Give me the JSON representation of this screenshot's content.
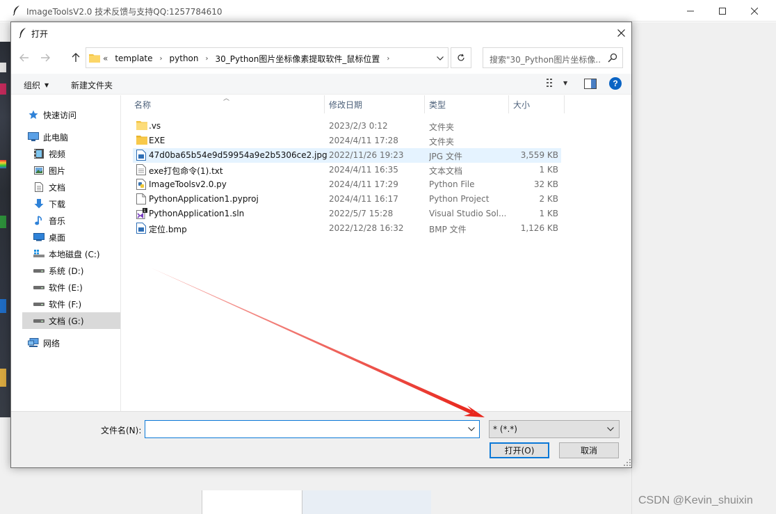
{
  "main_window": {
    "title": "ImageToolsV2.0 技术反馈与支持QQ:1257784610",
    "min_label": "—",
    "max_label": "☐",
    "close_label": "✕"
  },
  "dialog": {
    "title": "打开",
    "close_label": "✕",
    "address": {
      "lead": "«",
      "crumbs": [
        "template",
        "python",
        "30_Python图片坐标像素提取软件_鼠标位置"
      ],
      "separator": "›"
    },
    "search_placeholder": "搜索\"30_Python图片坐标像...",
    "toolbar": {
      "organize": "组织",
      "new_folder": "新建文件夹"
    },
    "nav": [
      {
        "label": "快速访问",
        "icon": "star-icon"
      },
      {
        "label": "此电脑",
        "icon": "computer-icon"
      },
      {
        "label": "视频",
        "icon": "video-icon"
      },
      {
        "label": "图片",
        "icon": "picture-icon"
      },
      {
        "label": "文档",
        "icon": "document-icon"
      },
      {
        "label": "下载",
        "icon": "download-icon"
      },
      {
        "label": "音乐",
        "icon": "music-icon"
      },
      {
        "label": "桌面",
        "icon": "desktop-icon"
      },
      {
        "label": "本地磁盘 (C:)",
        "icon": "windows-drive-icon"
      },
      {
        "label": "系统 (D:)",
        "icon": "drive-icon"
      },
      {
        "label": "软件 (E:)",
        "icon": "drive-icon"
      },
      {
        "label": "软件 (F:)",
        "icon": "drive-icon"
      },
      {
        "label": "文档 (G:)",
        "icon": "drive-icon",
        "selected": true
      },
      {
        "label": "网络",
        "icon": "network-icon"
      }
    ],
    "columns": {
      "name": "名称",
      "date": "修改日期",
      "type": "类型",
      "size": "大小"
    },
    "files": [
      {
        "name": ".vs",
        "date": "2023/2/3 0:12",
        "type": "文件夹",
        "size": "",
        "icon": "folder-icon"
      },
      {
        "name": "EXE",
        "date": "2024/4/11 17:28",
        "type": "文件夹",
        "size": "",
        "icon": "folder-icon"
      },
      {
        "name": "47d0ba65b54e9d59954a9e2b5306ce2.jpg",
        "date": "2022/11/26 19:23",
        "type": "JPG 文件",
        "size": "3,559 KB",
        "icon": "image-file-icon",
        "highlighted": true
      },
      {
        "name": "exe打包命令(1).txt",
        "date": "2024/4/11 16:35",
        "type": "文本文档",
        "size": "1 KB",
        "icon": "text-file-icon"
      },
      {
        "name": "ImageToolsv2.0.py",
        "date": "2024/4/11 17:29",
        "type": "Python File",
        "size": "32 KB",
        "icon": "python-file-icon"
      },
      {
        "name": "PythonApplication1.pyproj",
        "date": "2024/4/11 16:17",
        "type": "Python Project",
        "size": "2 KB",
        "icon": "blank-file-icon"
      },
      {
        "name": "PythonApplication1.sln",
        "date": "2022/5/7 15:28",
        "type": "Visual Studio Sol...",
        "size": "1 KB",
        "icon": "solution-file-icon"
      },
      {
        "name": "定位.bmp",
        "date": "2022/12/28 16:32",
        "type": "BMP 文件",
        "size": "1,126 KB",
        "icon": "image-file-icon"
      }
    ],
    "bottom": {
      "filename_label": "文件名(N):",
      "filename_value": "",
      "filter": "* (*.*)",
      "open_button": "打开(O)",
      "cancel_button": "取消"
    }
  },
  "watermark": "CSDN @Kevin_shuixin",
  "colors": {
    "accent": "#0a78d7",
    "selection": "#e5f3ff",
    "arrow": "#e8261c"
  }
}
